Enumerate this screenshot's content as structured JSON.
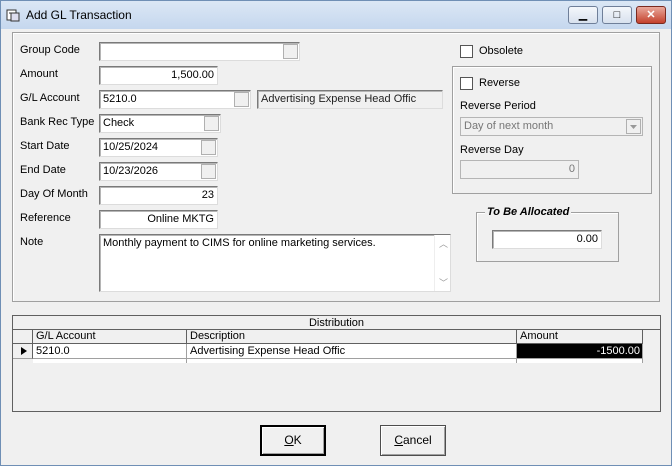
{
  "window": {
    "title": "Add GL Transaction",
    "minimize_glyph": "▁",
    "maximize_glyph": "□",
    "close_glyph": "✕",
    "app_icon": "ledger-app-icon"
  },
  "form": {
    "group_code": {
      "label": "Group Code",
      "value": ""
    },
    "amount": {
      "label": "Amount",
      "value": "1,500.00"
    },
    "gl_account": {
      "label": "G/L Account",
      "value": "5210.0",
      "description": "Advertising Expense Head Offic"
    },
    "bank_rec_type": {
      "label": "Bank Rec Type",
      "value": "Check"
    },
    "start_date": {
      "label": "Start Date",
      "value": "10/25/2024"
    },
    "end_date": {
      "label": "End Date",
      "value": "10/23/2026"
    },
    "day_of_month": {
      "label": "Day Of Month",
      "value": "23"
    },
    "reference": {
      "label": "Reference",
      "value": "Online MKTG"
    },
    "note": {
      "label": "Note",
      "value": "Monthly payment to CIMS for online marketing services."
    }
  },
  "options": {
    "obsolete": {
      "label": "Obsolete",
      "checked": false
    },
    "reverse": {
      "label": "Reverse",
      "checked": false
    },
    "reverse_period": {
      "label": "Reverse Period",
      "value": "Day of next month"
    },
    "reverse_day": {
      "label": "Reverse Day",
      "value": "0"
    }
  },
  "allocation": {
    "title": "To Be Allocated",
    "value": "0.00"
  },
  "distribution": {
    "caption": "Distribution",
    "columns": [
      "G/L Account",
      "Description",
      "Amount"
    ],
    "rows": [
      {
        "account": "5210.0",
        "description": "Advertising Expense Head Offic",
        "amount": "-1500.00"
      }
    ]
  },
  "buttons": {
    "ok": {
      "label": "OK",
      "mnemonic": "O"
    },
    "cancel": {
      "label": "Cancel",
      "mnemonic": "C"
    }
  }
}
